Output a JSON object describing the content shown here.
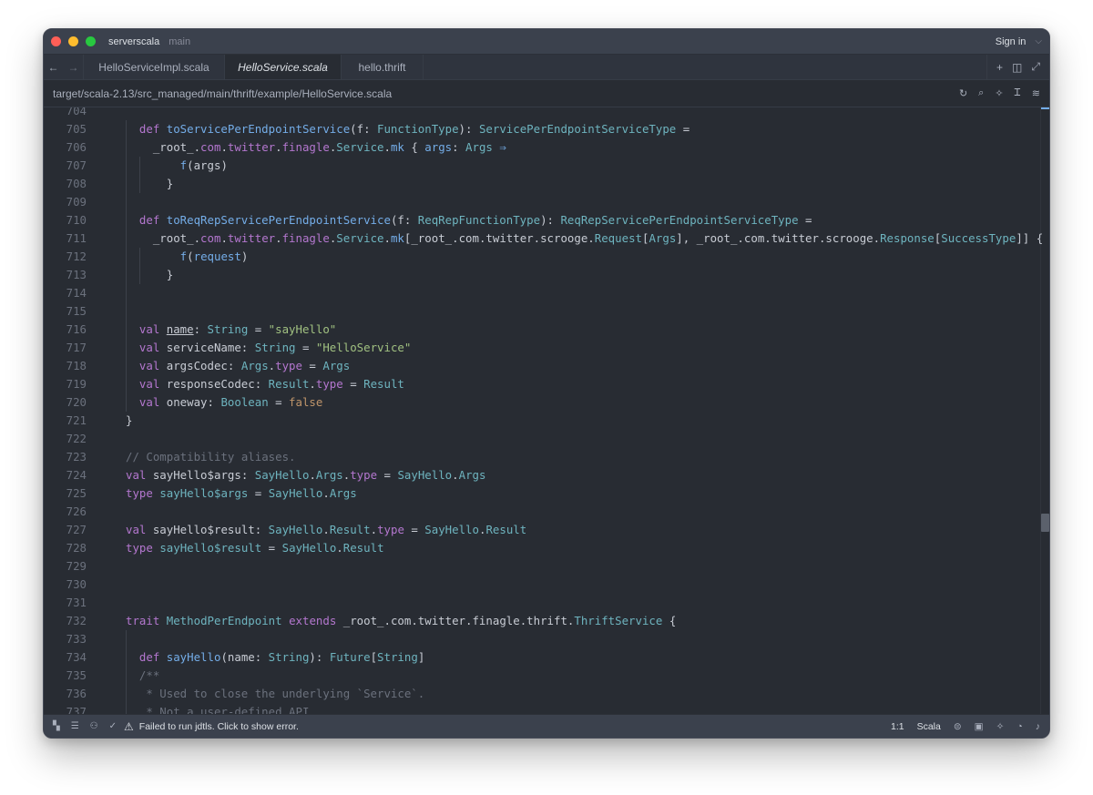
{
  "titlebar": {
    "project": "serverscala",
    "branch": "main",
    "signin": "Sign in",
    "chevron": "⌵"
  },
  "tabs": {
    "back": "←",
    "forward": "→",
    "items": [
      {
        "label": "HelloServiceImpl.scala",
        "active": false
      },
      {
        "label": "HelloService.scala",
        "active": true
      },
      {
        "label": "hello.thrift",
        "active": false
      }
    ],
    "actions": {
      "plus": "+",
      "split": "◫",
      "expand": "⤢"
    }
  },
  "breadcrumb": {
    "path": "target/scala-2.13/src_managed/main/thrift/example/HelloService.scala",
    "icons": {
      "refresh": "↻",
      "search": "⌕",
      "assistant": "✧",
      "cursor": "Ꮖ",
      "settings": "≋"
    }
  },
  "editor": {
    "lines": [
      {
        "n": "704",
        "indent": 0,
        "tokens": []
      },
      {
        "n": "705",
        "indent": 1,
        "tokens": [
          [
            "kw",
            "def "
          ],
          [
            "fn",
            "toServicePerEndpointService"
          ],
          [
            "pl",
            "(f: "
          ],
          [
            "ty",
            "FunctionType"
          ],
          [
            "pl",
            "): "
          ],
          [
            "ty",
            "ServicePerEndpointServiceType"
          ],
          [
            "pl",
            " ="
          ]
        ]
      },
      {
        "n": "706",
        "indent": 1,
        "tokens": [
          [
            "pl",
            "  _root_."
          ],
          [
            "kw",
            "com"
          ],
          [
            "pl",
            "."
          ],
          [
            "kw",
            "twitter"
          ],
          [
            "pl",
            "."
          ],
          [
            "kw",
            "finagle"
          ],
          [
            "pl",
            "."
          ],
          [
            "ty",
            "Service"
          ],
          [
            "pl",
            "."
          ],
          [
            "fn",
            "mk"
          ],
          [
            "pl",
            " { "
          ],
          [
            "fn",
            "args"
          ],
          [
            "pl",
            ": "
          ],
          [
            "ty",
            "Args"
          ],
          [
            "pl",
            " "
          ],
          [
            "fn",
            "⇒"
          ]
        ]
      },
      {
        "n": "707",
        "indent": 2,
        "tokens": [
          [
            "pl",
            "    "
          ],
          [
            "fn",
            "f"
          ],
          [
            "pl",
            "(args)"
          ]
        ]
      },
      {
        "n": "708",
        "indent": 2,
        "tokens": [
          [
            "pl",
            "  }"
          ]
        ]
      },
      {
        "n": "709",
        "indent": 1,
        "tokens": []
      },
      {
        "n": "710",
        "indent": 1,
        "tokens": [
          [
            "kw",
            "def "
          ],
          [
            "fn",
            "toReqRepServicePerEndpointService"
          ],
          [
            "pl",
            "(f: "
          ],
          [
            "ty",
            "ReqRepFunctionType"
          ],
          [
            "pl",
            "): "
          ],
          [
            "ty",
            "ReqRepServicePerEndpointServiceType"
          ],
          [
            "pl",
            " ="
          ]
        ]
      },
      {
        "n": "711",
        "indent": 1,
        "tokens": [
          [
            "pl",
            "  _root_."
          ],
          [
            "kw",
            "com"
          ],
          [
            "pl",
            "."
          ],
          [
            "kw",
            "twitter"
          ],
          [
            "pl",
            "."
          ],
          [
            "kw",
            "finagle"
          ],
          [
            "pl",
            "."
          ],
          [
            "ty",
            "Service"
          ],
          [
            "pl",
            "."
          ],
          [
            "fn",
            "mk"
          ],
          [
            "pl",
            "[_root_.com.twitter.scrooge."
          ],
          [
            "ty",
            "Request"
          ],
          [
            "pl",
            "["
          ],
          [
            "ty",
            "Args"
          ],
          [
            "pl",
            "], _root_.com.twitter.scrooge."
          ],
          [
            "ty",
            "Response"
          ],
          [
            "pl",
            "["
          ],
          [
            "ty",
            "SuccessType"
          ],
          [
            "pl",
            "]] { r"
          ]
        ]
      },
      {
        "n": "712",
        "indent": 2,
        "tokens": [
          [
            "pl",
            "    "
          ],
          [
            "fn",
            "f"
          ],
          [
            "pl",
            "("
          ],
          [
            "fn",
            "request"
          ],
          [
            "pl",
            ")"
          ]
        ]
      },
      {
        "n": "713",
        "indent": 2,
        "tokens": [
          [
            "pl",
            "  }"
          ]
        ]
      },
      {
        "n": "714",
        "indent": 1,
        "tokens": []
      },
      {
        "n": "715",
        "indent": 1,
        "tokens": []
      },
      {
        "n": "716",
        "indent": 1,
        "tokens": [
          [
            "kw",
            "val "
          ],
          [
            "ul",
            "name"
          ],
          [
            "pl",
            ": "
          ],
          [
            "ty",
            "String"
          ],
          [
            "pl",
            " = "
          ],
          [
            "str",
            "\"sayHello\""
          ]
        ]
      },
      {
        "n": "717",
        "indent": 1,
        "tokens": [
          [
            "kw",
            "val "
          ],
          [
            "pl",
            "serviceName: "
          ],
          [
            "ty",
            "String"
          ],
          [
            "pl",
            " = "
          ],
          [
            "str",
            "\"HelloService\""
          ]
        ]
      },
      {
        "n": "718",
        "indent": 1,
        "tokens": [
          [
            "kw",
            "val "
          ],
          [
            "pl",
            "argsCodec: "
          ],
          [
            "ty",
            "Args"
          ],
          [
            "pl",
            "."
          ],
          [
            "kw",
            "type"
          ],
          [
            "pl",
            " = "
          ],
          [
            "ty",
            "Args"
          ]
        ]
      },
      {
        "n": "719",
        "indent": 1,
        "tokens": [
          [
            "kw",
            "val "
          ],
          [
            "pl",
            "responseCodec: "
          ],
          [
            "ty",
            "Result"
          ],
          [
            "pl",
            "."
          ],
          [
            "kw",
            "type"
          ],
          [
            "pl",
            " = "
          ],
          [
            "ty",
            "Result"
          ]
        ]
      },
      {
        "n": "720",
        "indent": 1,
        "tokens": [
          [
            "kw",
            "val "
          ],
          [
            "pl",
            "oneway: "
          ],
          [
            "ty",
            "Boolean"
          ],
          [
            "pl",
            " = "
          ],
          [
            "bool",
            "false"
          ]
        ]
      },
      {
        "n": "721",
        "indent": 0,
        "tokens": [
          [
            "pl",
            "}"
          ]
        ]
      },
      {
        "n": "722",
        "indent": 0,
        "tokens": []
      },
      {
        "n": "723",
        "indent": 0,
        "tokens": [
          [
            "cm",
            "// Compatibility aliases."
          ]
        ]
      },
      {
        "n": "724",
        "indent": 0,
        "tokens": [
          [
            "kw",
            "val "
          ],
          [
            "pl",
            "sayHello$args: "
          ],
          [
            "ty",
            "SayHello"
          ],
          [
            "pl",
            "."
          ],
          [
            "ty",
            "Args"
          ],
          [
            "pl",
            "."
          ],
          [
            "kw",
            "type"
          ],
          [
            "pl",
            " = "
          ],
          [
            "ty",
            "SayHello"
          ],
          [
            "pl",
            "."
          ],
          [
            "ty",
            "Args"
          ]
        ]
      },
      {
        "n": "725",
        "indent": 0,
        "tokens": [
          [
            "kw",
            "type "
          ],
          [
            "ty",
            "sayHello$args"
          ],
          [
            "pl",
            " = "
          ],
          [
            "ty",
            "SayHello"
          ],
          [
            "pl",
            "."
          ],
          [
            "ty",
            "Args"
          ]
        ]
      },
      {
        "n": "726",
        "indent": 0,
        "tokens": []
      },
      {
        "n": "727",
        "indent": 0,
        "tokens": [
          [
            "kw",
            "val "
          ],
          [
            "pl",
            "sayHello$result: "
          ],
          [
            "ty",
            "SayHello"
          ],
          [
            "pl",
            "."
          ],
          [
            "ty",
            "Result"
          ],
          [
            "pl",
            "."
          ],
          [
            "kw",
            "type"
          ],
          [
            "pl",
            " = "
          ],
          [
            "ty",
            "SayHello"
          ],
          [
            "pl",
            "."
          ],
          [
            "ty",
            "Result"
          ]
        ]
      },
      {
        "n": "728",
        "indent": 0,
        "tokens": [
          [
            "kw",
            "type "
          ],
          [
            "ty",
            "sayHello$result"
          ],
          [
            "pl",
            " = "
          ],
          [
            "ty",
            "SayHello"
          ],
          [
            "pl",
            "."
          ],
          [
            "ty",
            "Result"
          ]
        ]
      },
      {
        "n": "729",
        "indent": 0,
        "tokens": []
      },
      {
        "n": "730",
        "indent": 0,
        "tokens": []
      },
      {
        "n": "731",
        "indent": 0,
        "tokens": []
      },
      {
        "n": "732",
        "indent": 0,
        "tokens": [
          [
            "kw",
            "trait "
          ],
          [
            "ty",
            "MethodPerEndpoint"
          ],
          [
            "pl",
            " "
          ],
          [
            "kw",
            "extends"
          ],
          [
            "pl",
            " _root_.com.twitter.finagle.thrift."
          ],
          [
            "ty",
            "ThriftService"
          ],
          [
            "pl",
            " {"
          ]
        ]
      },
      {
        "n": "733",
        "indent": 1,
        "tokens": []
      },
      {
        "n": "734",
        "indent": 1,
        "tokens": [
          [
            "kw",
            "def "
          ],
          [
            "fn",
            "sayHello"
          ],
          [
            "pl",
            "(name: "
          ],
          [
            "ty",
            "String"
          ],
          [
            "pl",
            "): "
          ],
          [
            "ty",
            "Future"
          ],
          [
            "pl",
            "["
          ],
          [
            "ty",
            "String"
          ],
          [
            "pl",
            "]"
          ]
        ]
      },
      {
        "n": "735",
        "indent": 1,
        "tokens": [
          [
            "cm",
            "/**"
          ]
        ]
      },
      {
        "n": "736",
        "indent": 1,
        "tokens": [
          [
            "cm",
            " * Used to close the underlying `Service`."
          ]
        ]
      },
      {
        "n": "737",
        "indent": 1,
        "tokens": [
          [
            "cm",
            " * Not a user-defined API."
          ]
        ]
      }
    ]
  },
  "statusbar": {
    "icons": {
      "project": "▚",
      "outline": "☰",
      "collab": "⚇",
      "check": "✓",
      "warning": "⚠"
    },
    "error_message": "Failed to run jdtls. Click to show error.",
    "cursor_position": "1:1",
    "language": "Scala",
    "right_icons": {
      "copilot": "⊜",
      "terminal": "▣",
      "assistant": "✧",
      "chat": "◔",
      "bell": "♪"
    }
  }
}
